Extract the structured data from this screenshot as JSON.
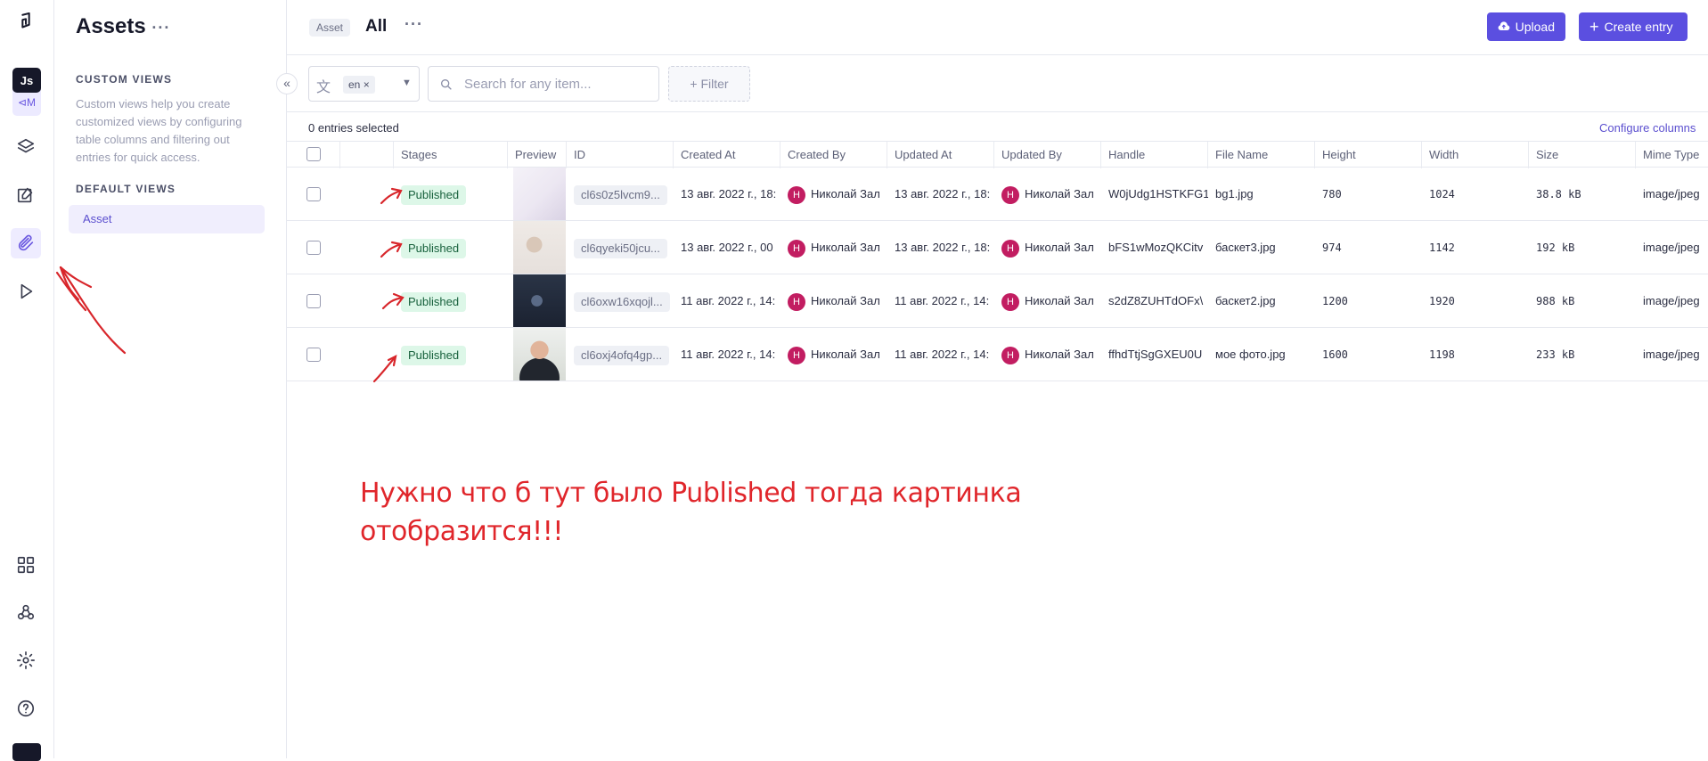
{
  "rail": {
    "project_initials": "Js",
    "project_sub": "⊲M"
  },
  "sidebar": {
    "title": "Assets",
    "custom_views_heading": "CUSTOM VIEWS",
    "custom_views_desc": "Custom views help you create customized views by configuring table columns and filtering out entries for quick access.",
    "default_views_heading": "DEFAULT VIEWS",
    "default_view": "Asset"
  },
  "header": {
    "breadcrumb": "Asset",
    "view": "All",
    "upload_label": "Upload",
    "create_label": "Create entry"
  },
  "toolbar": {
    "locale": "en",
    "search_placeholder": "Search for any item...",
    "filter_label": "Filter",
    "selected_text": "0 entries selected",
    "configure_columns": "Configure columns"
  },
  "table": {
    "columns": [
      "Stages",
      "Preview",
      "ID",
      "Created At",
      "Created By",
      "Updated At",
      "Updated By",
      "Handle",
      "File Name",
      "Height",
      "Width",
      "Size",
      "Mime Type"
    ],
    "rows": [
      {
        "stage": "Published",
        "id": "cl6s0z5lvcm9...",
        "created_at": "13 авг. 2022 г., 18:",
        "created_by": "Николай Зал",
        "updated_at": "13 авг. 2022 г., 18:",
        "updated_by": "Николай Зал",
        "avatar": "Н",
        "handle": "W0jUdg1HSTKFG1",
        "file_name": "bg1.jpg",
        "height": "780",
        "width": "1024",
        "size": "38.8 kB",
        "mime": "image/jpeg"
      },
      {
        "stage": "Published",
        "id": "cl6qyeki50jcu...",
        "created_at": "13 авг. 2022 г., 00",
        "created_by": "Николай Зал",
        "updated_at": "13 авг. 2022 г., 18:",
        "updated_by": "Николай Зал",
        "avatar": "Н",
        "handle": "bFS1wMozQKCitv",
        "file_name": "баскет3.jpg",
        "height": "974",
        "width": "1142",
        "size": "192 kB",
        "mime": "image/jpeg"
      },
      {
        "stage": "Published",
        "id": "cl6oxw16xqojl...",
        "created_at": "11 авг. 2022 г., 14:",
        "created_by": "Николай Зал",
        "updated_at": "11 авг. 2022 г., 14:",
        "updated_by": "Николай Зал",
        "avatar": "Н",
        "handle": "s2dZ8ZUHTdOFx\\",
        "file_name": "баскет2.jpg",
        "height": "1200",
        "width": "1920",
        "size": "988 kB",
        "mime": "image/jpeg"
      },
      {
        "stage": "Published",
        "id": "cl6oxj4ofq4gp...",
        "created_at": "11 авг. 2022 г., 14:",
        "created_by": "Николай Зал",
        "updated_at": "11 авг. 2022 г., 14:",
        "updated_by": "Николай Зал",
        "avatar": "Н",
        "handle": "ffhdTtjSgGXEU0U",
        "file_name": "мое фото.jpg",
        "height": "1600",
        "width": "1198",
        "size": "233 kB",
        "mime": "image/jpeg"
      }
    ]
  },
  "annotation": {
    "line1": "Нужно что  б тут было Published тогда картинка",
    "line2": "отобразится!!!"
  }
}
